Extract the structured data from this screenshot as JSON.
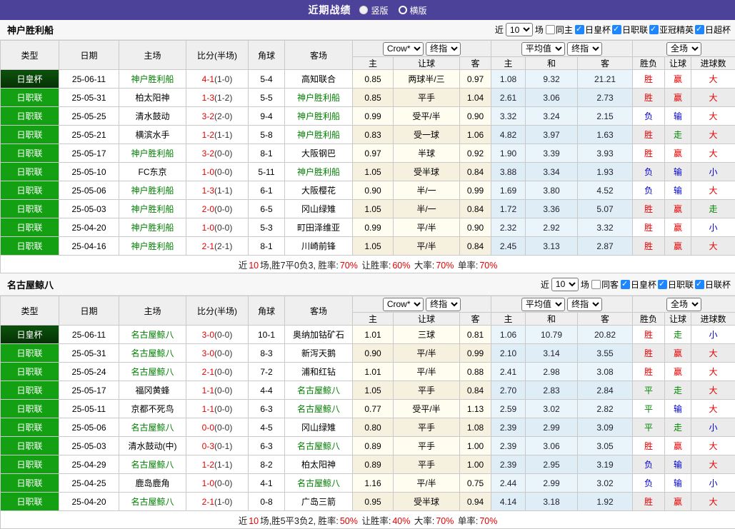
{
  "top_bar": {
    "title": "近期战绩",
    "radio_vertical": "竖版",
    "radio_horizontal": "横版"
  },
  "columns": {
    "type": "类型",
    "date": "日期",
    "home": "主场",
    "score": "比分(半场)",
    "corner": "角球",
    "away": "客场",
    "h": "主",
    "handicap": "让球",
    "a": "客",
    "draw": "和",
    "result": "胜负",
    "goals": "进球数"
  },
  "dropdowns": {
    "crow": "Crow*",
    "final": "终指",
    "avg": "平均值",
    "full": "全场"
  },
  "sections": [
    {
      "team": "神户胜利船",
      "filter": {
        "near": "近",
        "count": "10",
        "games": "场",
        "same_side": "同主",
        "leagues": [
          "日皇杯",
          "日职联",
          "亚冠精英",
          "日超杯"
        ]
      },
      "rows": [
        {
          "type": "日皇杯",
          "type_c": "cup",
          "date": "25-06-11",
          "home": "神户胜利船",
          "home_c": "team",
          "score": "4-1",
          "half": "(1-0)",
          "corner": "5-4",
          "away": "高知联合",
          "away_c": "plain",
          "crow_home": "0.85",
          "crow_hcp": "两球半/三",
          "crow_away": "0.97",
          "avg_home": "1.08",
          "avg_draw": "9.32",
          "avg_away": "21.21",
          "res": "胜",
          "res_c": "r",
          "hcp_res": "赢",
          "hcp_res_c": "r",
          "goal_res": "大",
          "goal_res_c": "r"
        },
        {
          "type": "日职联",
          "type_c": "league",
          "date": "25-05-31",
          "home": "柏太阳神",
          "home_c": "plain",
          "score": "1-3",
          "half": "(1-2)",
          "corner": "5-5",
          "away": "神户胜利船",
          "away_c": "team",
          "crow_home": "0.85",
          "crow_hcp": "平手",
          "crow_away": "1.04",
          "avg_home": "2.61",
          "avg_draw": "3.06",
          "avg_away": "2.73",
          "res": "胜",
          "res_c": "r",
          "hcp_res": "赢",
          "hcp_res_c": "r",
          "goal_res": "大",
          "goal_res_c": "r"
        },
        {
          "type": "日职联",
          "type_c": "league",
          "date": "25-05-25",
          "home": "清水鼓动",
          "home_c": "plain",
          "score": "3-2",
          "half": "(2-0)",
          "corner": "9-4",
          "away": "神户胜利船",
          "away_c": "team",
          "crow_home": "0.99",
          "crow_hcp": "受平/半",
          "crow_away": "0.90",
          "avg_home": "3.32",
          "avg_draw": "3.24",
          "avg_away": "2.15",
          "res": "负",
          "res_c": "b",
          "hcp_res": "输",
          "hcp_res_c": "b",
          "goal_res": "大",
          "goal_res_c": "r"
        },
        {
          "type": "日职联",
          "type_c": "league",
          "date": "25-05-21",
          "home": "横滨水手",
          "home_c": "plain",
          "score": "1-2",
          "half": "(1-1)",
          "corner": "5-8",
          "away": "神户胜利船",
          "away_c": "team",
          "crow_home": "0.83",
          "crow_hcp": "受一球",
          "crow_away": "1.06",
          "avg_home": "4.82",
          "avg_draw": "3.97",
          "avg_away": "1.63",
          "res": "胜",
          "res_c": "r",
          "hcp_res": "走",
          "hcp_res_c": "g",
          "goal_res": "大",
          "goal_res_c": "r"
        },
        {
          "type": "日职联",
          "type_c": "league",
          "date": "25-05-17",
          "home": "神户胜利船",
          "home_c": "team",
          "score": "3-2",
          "half": "(0-0)",
          "corner": "8-1",
          "away": "大阪钢巴",
          "away_c": "plain",
          "crow_home": "0.97",
          "crow_hcp": "半球",
          "crow_away": "0.92",
          "avg_home": "1.90",
          "avg_draw": "3.39",
          "avg_away": "3.93",
          "res": "胜",
          "res_c": "r",
          "hcp_res": "赢",
          "hcp_res_c": "r",
          "goal_res": "大",
          "goal_res_c": "r"
        },
        {
          "type": "日职联",
          "type_c": "league",
          "date": "25-05-10",
          "home": "FC东京",
          "home_c": "plain",
          "score": "1-0",
          "half": "(0-0)",
          "corner": "5-11",
          "away": "神户胜利船",
          "away_c": "team",
          "crow_home": "1.05",
          "crow_hcp": "受半球",
          "crow_away": "0.84",
          "avg_home": "3.88",
          "avg_draw": "3.34",
          "avg_away": "1.93",
          "res": "负",
          "res_c": "b",
          "hcp_res": "输",
          "hcp_res_c": "b",
          "goal_res": "小",
          "goal_res_c": "b"
        },
        {
          "type": "日职联",
          "type_c": "league",
          "date": "25-05-06",
          "home": "神户胜利船",
          "home_c": "team",
          "score": "1-3",
          "half": "(1-1)",
          "corner": "6-1",
          "away": "大阪樱花",
          "away_c": "plain",
          "crow_home": "0.90",
          "crow_hcp": "半/一",
          "crow_away": "0.99",
          "avg_home": "1.69",
          "avg_draw": "3.80",
          "avg_away": "4.52",
          "res": "负",
          "res_c": "b",
          "hcp_res": "输",
          "hcp_res_c": "b",
          "goal_res": "大",
          "goal_res_c": "r"
        },
        {
          "type": "日职联",
          "type_c": "league",
          "date": "25-05-03",
          "home": "神户胜利船",
          "home_c": "team",
          "score": "2-0",
          "half": "(0-0)",
          "corner": "6-5",
          "away": "冈山绿雉",
          "away_c": "plain",
          "crow_home": "1.05",
          "crow_hcp": "半/一",
          "crow_away": "0.84",
          "avg_home": "1.72",
          "avg_draw": "3.36",
          "avg_away": "5.07",
          "res": "胜",
          "res_c": "r",
          "hcp_res": "赢",
          "hcp_res_c": "r",
          "goal_res": "走",
          "goal_res_c": "g"
        },
        {
          "type": "日职联",
          "type_c": "league",
          "date": "25-04-20",
          "home": "神户胜利船",
          "home_c": "team",
          "score": "1-0",
          "half": "(0-0)",
          "corner": "5-3",
          "away": "町田泽维亚",
          "away_c": "plain",
          "crow_home": "0.99",
          "crow_hcp": "平/半",
          "crow_away": "0.90",
          "avg_home": "2.32",
          "avg_draw": "2.92",
          "avg_away": "3.32",
          "res": "胜",
          "res_c": "r",
          "hcp_res": "赢",
          "hcp_res_c": "r",
          "goal_res": "小",
          "goal_res_c": "b"
        },
        {
          "type": "日职联",
          "type_c": "league",
          "date": "25-04-16",
          "home": "神户胜利船",
          "home_c": "team",
          "score": "2-1",
          "half": "(2-1)",
          "corner": "8-1",
          "away": "川崎前锋",
          "away_c": "plain",
          "crow_home": "1.05",
          "crow_hcp": "平/半",
          "crow_away": "0.84",
          "avg_home": "2.45",
          "avg_draw": "3.13",
          "avg_away": "2.87",
          "res": "胜",
          "res_c": "r",
          "hcp_res": "赢",
          "hcp_res_c": "r",
          "goal_res": "大",
          "goal_res_c": "r"
        }
      ],
      "summary": [
        {
          "t": "近",
          "c": "k"
        },
        {
          "t": "10",
          "c": "r"
        },
        {
          "t": "场,胜7平0负3, 胜率:",
          "c": "k"
        },
        {
          "t": "70%",
          "c": "r"
        },
        {
          "t": " 让胜率:",
          "c": "k"
        },
        {
          "t": "60%",
          "c": "r"
        },
        {
          "t": " 大率:",
          "c": "k"
        },
        {
          "t": "70%",
          "c": "r"
        },
        {
          "t": " 单率:",
          "c": "k"
        },
        {
          "t": "70%",
          "c": "r"
        }
      ]
    },
    {
      "team": "名古屋鲸八",
      "filter": {
        "near": "近",
        "count": "10",
        "games": "场",
        "same_side": "同客",
        "leagues": [
          "日皇杯",
          "日职联",
          "日联杯"
        ]
      },
      "rows": [
        {
          "type": "日皇杯",
          "type_c": "cup",
          "date": "25-06-11",
          "home": "名古屋鲸八",
          "home_c": "team",
          "score": "3-0",
          "half": "(0-0)",
          "corner": "10-1",
          "away": "奥纳加钴矿石",
          "away_c": "plain",
          "crow_home": "1.01",
          "crow_hcp": "三球",
          "crow_away": "0.81",
          "avg_home": "1.06",
          "avg_draw": "10.79",
          "avg_away": "20.82",
          "res": "胜",
          "res_c": "r",
          "hcp_res": "走",
          "hcp_res_c": "g",
          "goal_res": "小",
          "goal_res_c": "b"
        },
        {
          "type": "日职联",
          "type_c": "league",
          "date": "25-05-31",
          "home": "名古屋鲸八",
          "home_c": "team",
          "score": "3-0",
          "half": "(0-0)",
          "corner": "8-3",
          "away": "新泻天鹅",
          "away_c": "plain",
          "crow_home": "0.90",
          "crow_hcp": "平/半",
          "crow_away": "0.99",
          "avg_home": "2.10",
          "avg_draw": "3.14",
          "avg_away": "3.55",
          "res": "胜",
          "res_c": "r",
          "hcp_res": "赢",
          "hcp_res_c": "r",
          "goal_res": "大",
          "goal_res_c": "r"
        },
        {
          "type": "日职联",
          "type_c": "league",
          "date": "25-05-24",
          "home": "名古屋鲸八",
          "home_c": "team",
          "score": "2-1",
          "half": "(0-0)",
          "corner": "7-2",
          "away": "浦和红钻",
          "away_c": "plain",
          "crow_home": "1.01",
          "crow_hcp": "平/半",
          "crow_away": "0.88",
          "avg_home": "2.41",
          "avg_draw": "2.98",
          "avg_away": "3.08",
          "res": "胜",
          "res_c": "r",
          "hcp_res": "赢",
          "hcp_res_c": "r",
          "goal_res": "大",
          "goal_res_c": "r"
        },
        {
          "type": "日职联",
          "type_c": "league",
          "date": "25-05-17",
          "home": "福冈黄蜂",
          "home_c": "plain",
          "score": "1-1",
          "half": "(0-0)",
          "corner": "4-4",
          "away": "名古屋鲸八",
          "away_c": "team",
          "crow_home": "1.05",
          "crow_hcp": "平手",
          "crow_away": "0.84",
          "avg_home": "2.70",
          "avg_draw": "2.83",
          "avg_away": "2.84",
          "res": "平",
          "res_c": "g",
          "hcp_res": "走",
          "hcp_res_c": "g",
          "goal_res": "大",
          "goal_res_c": "r"
        },
        {
          "type": "日职联",
          "type_c": "league",
          "date": "25-05-11",
          "home": "京都不死鸟",
          "home_c": "plain",
          "score": "1-1",
          "half": "(0-0)",
          "corner": "6-3",
          "away": "名古屋鲸八",
          "away_c": "team",
          "crow_home": "0.77",
          "crow_hcp": "受平/半",
          "crow_away": "1.13",
          "avg_home": "2.59",
          "avg_draw": "3.02",
          "avg_away": "2.82",
          "res": "平",
          "res_c": "g",
          "hcp_res": "输",
          "hcp_res_c": "b",
          "goal_res": "大",
          "goal_res_c": "r"
        },
        {
          "type": "日职联",
          "type_c": "league",
          "date": "25-05-06",
          "home": "名古屋鲸八",
          "home_c": "team",
          "score": "0-0",
          "half": "(0-0)",
          "corner": "4-5",
          "away": "冈山绿雉",
          "away_c": "plain",
          "crow_home": "0.80",
          "crow_hcp": "平手",
          "crow_away": "1.08",
          "avg_home": "2.39",
          "avg_draw": "2.99",
          "avg_away": "3.09",
          "res": "平",
          "res_c": "g",
          "hcp_res": "走",
          "hcp_res_c": "g",
          "goal_res": "小",
          "goal_res_c": "b"
        },
        {
          "type": "日职联",
          "type_c": "league",
          "date": "25-05-03",
          "home": "清水鼓动(中)",
          "home_c": "plain",
          "score": "0-3",
          "half": "(0-1)",
          "corner": "6-3",
          "away": "名古屋鲸八",
          "away_c": "team",
          "crow_home": "0.89",
          "crow_hcp": "平手",
          "crow_away": "1.00",
          "avg_home": "2.39",
          "avg_draw": "3.06",
          "avg_away": "3.05",
          "res": "胜",
          "res_c": "r",
          "hcp_res": "赢",
          "hcp_res_c": "r",
          "goal_res": "大",
          "goal_res_c": "r"
        },
        {
          "type": "日职联",
          "type_c": "league",
          "date": "25-04-29",
          "home": "名古屋鲸八",
          "home_c": "team",
          "score": "1-2",
          "half": "(1-1)",
          "corner": "8-2",
          "away": "柏太阳神",
          "away_c": "plain",
          "crow_home": "0.89",
          "crow_hcp": "平手",
          "crow_away": "1.00",
          "avg_home": "2.39",
          "avg_draw": "2.95",
          "avg_away": "3.19",
          "res": "负",
          "res_c": "b",
          "hcp_res": "输",
          "hcp_res_c": "b",
          "goal_res": "大",
          "goal_res_c": "r"
        },
        {
          "type": "日职联",
          "type_c": "league",
          "date": "25-04-25",
          "home": "鹿岛鹿角",
          "home_c": "plain",
          "score": "1-0",
          "half": "(0-0)",
          "corner": "4-1",
          "away": "名古屋鲸八",
          "away_c": "team",
          "crow_home": "1.16",
          "crow_hcp": "平/半",
          "crow_away": "0.75",
          "avg_home": "2.44",
          "avg_draw": "2.99",
          "avg_away": "3.02",
          "res": "负",
          "res_c": "b",
          "hcp_res": "输",
          "hcp_res_c": "b",
          "goal_res": "小",
          "goal_res_c": "b"
        },
        {
          "type": "日职联",
          "type_c": "league",
          "date": "25-04-20",
          "home": "名古屋鲸八",
          "home_c": "team",
          "score": "2-1",
          "half": "(1-0)",
          "corner": "0-8",
          "away": "广岛三箭",
          "away_c": "plain",
          "crow_home": "0.95",
          "crow_hcp": "受半球",
          "crow_away": "0.94",
          "avg_home": "4.14",
          "avg_draw": "3.18",
          "avg_away": "1.92",
          "res": "胜",
          "res_c": "r",
          "hcp_res": "赢",
          "hcp_res_c": "r",
          "goal_res": "大",
          "goal_res_c": "r"
        }
      ],
      "summary": [
        {
          "t": "近",
          "c": "k"
        },
        {
          "t": "10",
          "c": "r"
        },
        {
          "t": "场,胜5平3负2, 胜率:",
          "c": "k"
        },
        {
          "t": "50%",
          "c": "r"
        },
        {
          "t": " 让胜率:",
          "c": "k"
        },
        {
          "t": "40%",
          "c": "r"
        },
        {
          "t": " 大率:",
          "c": "k"
        },
        {
          "t": "70%",
          "c": "r"
        },
        {
          "t": " 单率:",
          "c": "k"
        },
        {
          "t": "70%",
          "c": "r"
        }
      ]
    }
  ]
}
